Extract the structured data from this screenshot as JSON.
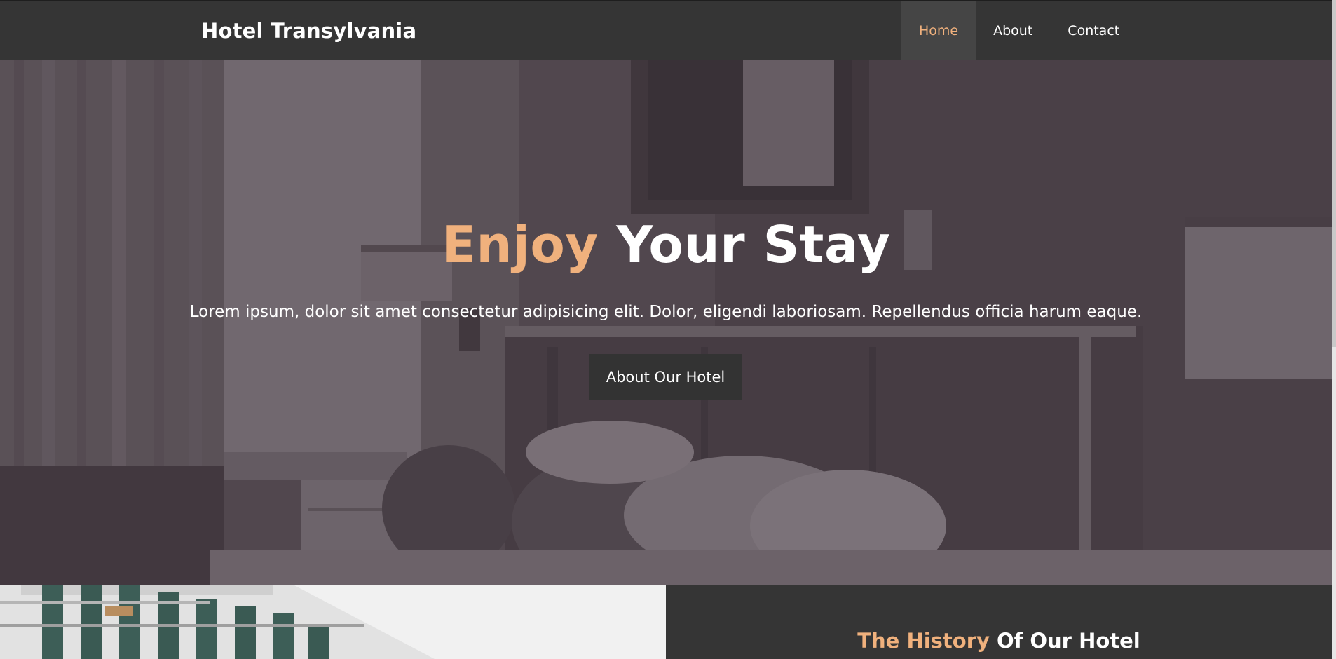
{
  "header": {
    "brand": "Hotel Transylvania",
    "nav": [
      {
        "label": "Home",
        "active": true
      },
      {
        "label": "About",
        "active": false
      },
      {
        "label": "Contact",
        "active": false
      }
    ]
  },
  "hero": {
    "title_accent": "Enjoy",
    "title_rest": " Your Stay",
    "text": "Lorem ipsum, dolor sit amet consectetur adipisicing elit. Dolor, eligendi laboriosam. Repellendus officia harum eaque.",
    "button_label": "About Our Hotel"
  },
  "history": {
    "title_accent": "The History",
    "title_rest": " Of Our Hotel"
  },
  "colors": {
    "accent": "#f0b17d",
    "nav_bg": "#353535",
    "button_bg": "#333333"
  }
}
